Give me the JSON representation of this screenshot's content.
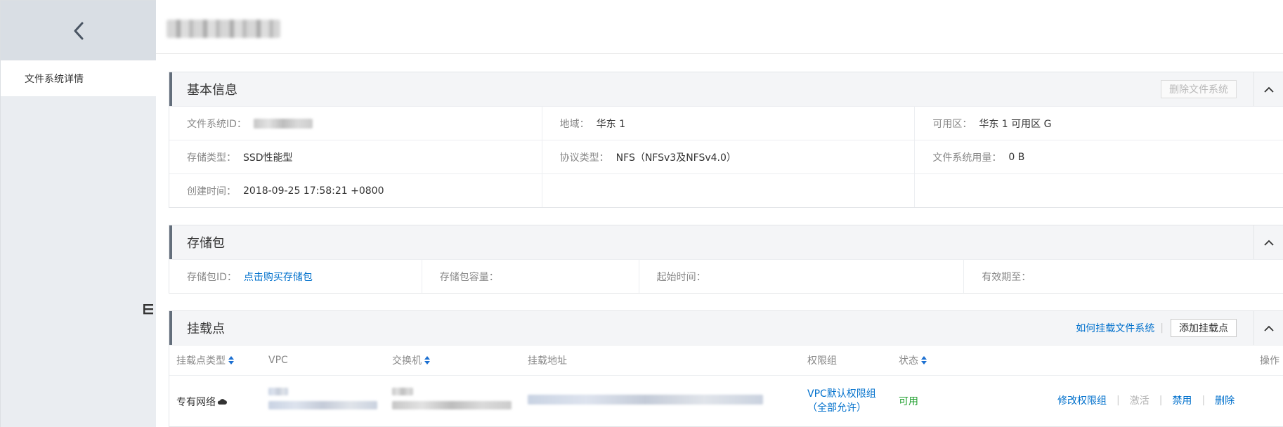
{
  "sidebar": {
    "back_icon": "chevron-left-icon",
    "items": [
      {
        "label": "文件系统详情"
      }
    ]
  },
  "basic": {
    "title": "基本信息",
    "delete_label": "删除文件系统",
    "fs_id_label": "文件系统ID：",
    "region_label": "地域：",
    "region_value": "华东 1",
    "zone_label": "可用区：",
    "zone_value": "华东 1 可用区 G",
    "storage_type_label": "存储类型：",
    "storage_type_value": "SSD性能型",
    "protocol_label": "协议类型：",
    "protocol_value": "NFS（NFSv3及NFSv4.0）",
    "usage_label": "文件系统用量：",
    "usage_value": "0 B",
    "created_label": "创建时间：",
    "created_value": "2018-09-25 17:58:21 +0800"
  },
  "package": {
    "title": "存储包",
    "id_label": "存储包ID：",
    "id_link": "点击购买存储包",
    "capacity_label": "存储包容量：",
    "start_label": "起始时间：",
    "expire_label": "有效期至："
  },
  "mount": {
    "title": "挂载点",
    "howto_link": "如何挂载文件系统",
    "add_button": "添加挂载点",
    "columns": {
      "type": "挂载点类型",
      "vpc": "VPC",
      "vswitch": "交换机",
      "address": "挂载地址",
      "group": "权限组",
      "status": "状态",
      "action": "操作"
    },
    "rows": [
      {
        "type": "专有网络",
        "group_line1": "VPC默认权限组",
        "group_line2": "（全部允许）",
        "status": "可用",
        "actions": {
          "modify": "修改权限组",
          "activate": "激活",
          "disable": "禁用",
          "delete": "删除"
        }
      }
    ]
  },
  "colors": {
    "accent": "#0070cc",
    "ok": "#1e9e2c",
    "bar": "#636e7b"
  }
}
